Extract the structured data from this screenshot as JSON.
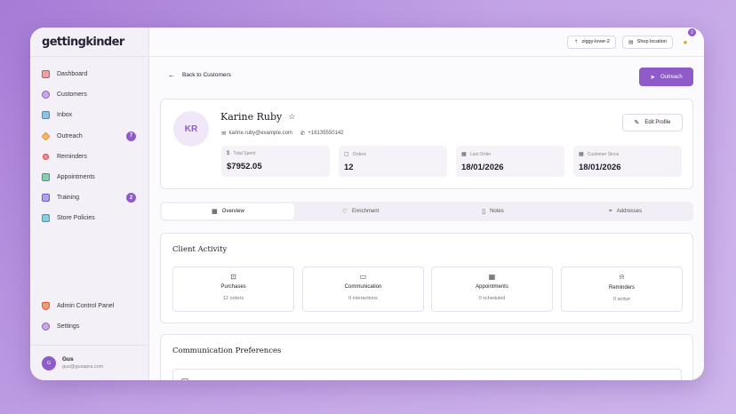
{
  "brand": "gettingkinder",
  "sidebar": {
    "items": [
      {
        "label": "Dashboard",
        "icon": "home-icon",
        "color": "#d9534f"
      },
      {
        "label": "Customers",
        "icon": "users-icon",
        "color": "#8e5bc9"
      },
      {
        "label": "Inbox",
        "icon": "mail-icon",
        "color": "#3a8ed8"
      },
      {
        "label": "Outreach",
        "icon": "send-icon",
        "color": "#e58a2a",
        "badge": "7"
      },
      {
        "label": "Reminders",
        "icon": "bell-icon",
        "color": "#e0434a"
      },
      {
        "label": "Appointments",
        "icon": "calendar-icon",
        "color": "#2fa17a"
      },
      {
        "label": "Training",
        "icon": "graduation-icon",
        "color": "#6a5bd0",
        "badge": "2"
      },
      {
        "label": "Store Policies",
        "icon": "book-icon",
        "color": "#2aa1c9"
      }
    ],
    "bottom": [
      {
        "label": "Admin Control Panel",
        "icon": "shield-icon",
        "color": "#e4572e"
      },
      {
        "label": "Settings",
        "icon": "gear-icon",
        "color": "#8e5bc9"
      }
    ],
    "user": {
      "initial": "G",
      "name": "Gus",
      "email": "gus@gusapra.com"
    }
  },
  "topbar": {
    "user_button": "ziggy-lover-2",
    "shop_button": "Shop location",
    "notif_count": "2"
  },
  "back_label": "Back to Customers",
  "outreach_label": "Outreach",
  "profile": {
    "initials": "KR",
    "name": "Karine Ruby",
    "email": "karine.ruby@example.com",
    "phone": "+16135550142",
    "edit_label": "Edit Profile",
    "stats": [
      {
        "label": "Total Spent",
        "value": "$7952.05",
        "icon": "dollar-icon"
      },
      {
        "label": "Orders",
        "value": "12",
        "icon": "box-icon"
      },
      {
        "label": "Last Order",
        "value": "18/01/2026",
        "icon": "calendar-icon"
      },
      {
        "label": "Customer Since",
        "value": "18/01/2026",
        "icon": "calendar-icon"
      }
    ]
  },
  "tabs": [
    {
      "label": "Overview",
      "icon": "grid-icon"
    },
    {
      "label": "Enrichment",
      "icon": "heart-icon"
    },
    {
      "label": "Notes",
      "icon": "note-icon"
    },
    {
      "label": "Addresses",
      "icon": "pin-icon"
    }
  ],
  "activity": {
    "title": "Client Activity",
    "items": [
      {
        "title": "Purchases",
        "sub": "12 orders",
        "icon": "bag-icon"
      },
      {
        "title": "Communication",
        "sub": "0 interactions",
        "icon": "chat-icon"
      },
      {
        "title": "Appointments",
        "sub": "0 scheduled",
        "icon": "calendar-icon"
      },
      {
        "title": "Reminders",
        "sub": "0 active",
        "icon": "bell-icon"
      }
    ]
  },
  "comm": {
    "title": "Communication Preferences"
  }
}
